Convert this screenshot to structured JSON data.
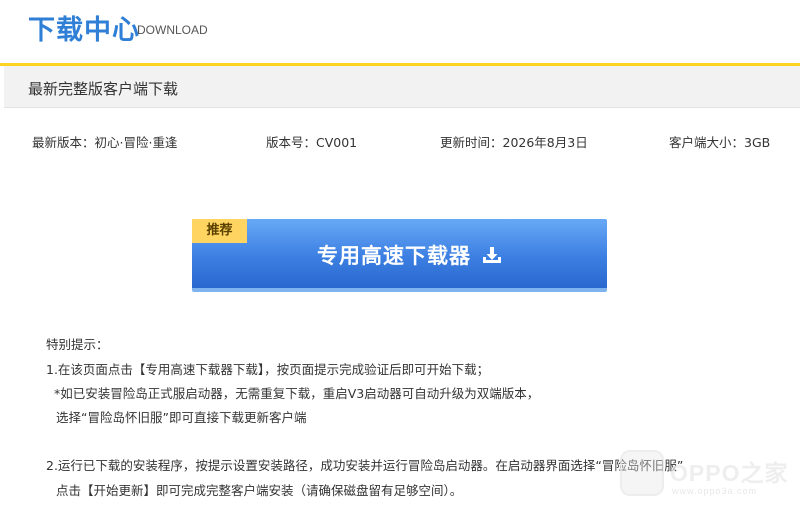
{
  "header": {
    "title": "下载中心",
    "subtitle": "DOWNLOAD"
  },
  "subbar": {
    "title": "最新完整版客户端下载"
  },
  "info": {
    "version_name": "最新版本：初心·冒险·重逢",
    "version_no": "版本号：CV001",
    "update_time": "更新时间：2026年8月3日",
    "client_size": "客户端大小：3GB"
  },
  "download_button": {
    "tag": "推荐",
    "label": "专用高速下载器",
    "icon": "download-icon"
  },
  "notes": {
    "heading": "特别提示：",
    "line1": "1.在该页面点击【专用高速下载器下载】，按页面提示完成验证后即可开始下载；",
    "line2": "*如已安装冒险岛正式服启动器，无需重复下载，重启V3启动器可自动升级为双端版本，",
    "line3": "选择“冒险岛怀旧服”即可直接下载更新客户端",
    "line4": "2.运行已下载的安装程序，按提示设置安装路径，成功安装并运行冒险岛启动器。在启动器界面选择“冒险岛怀旧服”",
    "line5": "点击【开始更新】即可完成完整客户端安装（请确保磁盘留有足够空间）。"
  },
  "watermark": {
    "text": "OPPO之家",
    "url": "www.oppo3a.com"
  },
  "colors": {
    "brand_blue": "#2f7fd6",
    "accent_yellow": "#ffd324",
    "button_blue": "#3c7fe2",
    "tag_yellow": "#ffd460"
  }
}
